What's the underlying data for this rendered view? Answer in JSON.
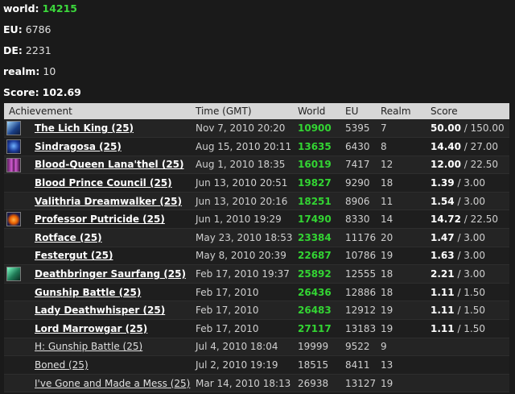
{
  "summary": [
    {
      "key": "world:",
      "value": "14215",
      "style": "green"
    },
    {
      "key": "EU:",
      "value": "6786",
      "style": "normal"
    },
    {
      "key": "DE:",
      "value": "2231",
      "style": "normal"
    },
    {
      "key": "realm:",
      "value": "10",
      "style": "normal"
    },
    {
      "key": "Score:",
      "value": "102.69",
      "style": "bold"
    }
  ],
  "table": {
    "headers": {
      "achievement": "Achievement",
      "time": "Time (GMT)",
      "world": "World",
      "eu": "EU",
      "realm": "Realm",
      "score": "Score"
    },
    "rows": [
      {
        "icon": "lich-king-icon",
        "icon_class": "lich",
        "name": "The Lich King (25)",
        "bold": true,
        "time": "Nov 7, 2010 20:20",
        "world": "10900",
        "world_green": true,
        "eu": "5395",
        "realm": "7",
        "score": "50.00",
        "max": "/ 150.00"
      },
      {
        "icon": "sindragosa-icon",
        "icon_class": "sind",
        "name": "Sindragosa (25)",
        "bold": true,
        "time": "Aug 15, 2010 20:11",
        "world": "13635",
        "world_green": true,
        "eu": "6430",
        "realm": "8",
        "score": "14.40",
        "max": "/ 27.00"
      },
      {
        "icon": "blood-queen-icon",
        "icon_class": "bq",
        "name": "Blood-Queen Lana'thel (25)",
        "bold": true,
        "time": "Aug 1, 2010 18:35",
        "world": "16019",
        "world_green": true,
        "eu": "7417",
        "realm": "12",
        "score": "12.00",
        "max": "/ 22.50"
      },
      {
        "icon": "",
        "icon_class": "",
        "name": "Blood Prince Council (25)",
        "bold": true,
        "time": "Jun 13, 2010 20:51",
        "world": "19827",
        "world_green": true,
        "eu": "9290",
        "realm": "18",
        "score": "1.39",
        "max": "/ 3.00"
      },
      {
        "icon": "",
        "icon_class": "",
        "name": "Valithria Dreamwalker (25)",
        "bold": true,
        "time": "Jun 13, 2010 20:16",
        "world": "18251",
        "world_green": true,
        "eu": "8906",
        "realm": "11",
        "score": "1.54",
        "max": "/ 3.00"
      },
      {
        "icon": "professor-putricide-icon",
        "icon_class": "pp",
        "name": "Professor Putricide (25)",
        "bold": true,
        "time": "Jun 1, 2010 19:29",
        "world": "17490",
        "world_green": true,
        "eu": "8330",
        "realm": "14",
        "score": "14.72",
        "max": "/ 22.50"
      },
      {
        "icon": "",
        "icon_class": "",
        "name": "Rotface (25)",
        "bold": true,
        "time": "May 23, 2010 18:53",
        "world": "23384",
        "world_green": true,
        "eu": "11176",
        "realm": "20",
        "score": "1.47",
        "max": "/ 3.00"
      },
      {
        "icon": "",
        "icon_class": "",
        "name": "Festergut (25)",
        "bold": true,
        "time": "May 8, 2010 20:39",
        "world": "22687",
        "world_green": true,
        "eu": "10786",
        "realm": "19",
        "score": "1.63",
        "max": "/ 3.00"
      },
      {
        "icon": "deathbringer-saurfang-icon",
        "icon_class": "saur",
        "name": "Deathbringer Saurfang (25)",
        "bold": true,
        "time": "Feb 17, 2010 19:37",
        "world": "25892",
        "world_green": true,
        "eu": "12555",
        "realm": "18",
        "score": "2.21",
        "max": "/ 3.00"
      },
      {
        "icon": "",
        "icon_class": "",
        "name": "Gunship Battle (25)",
        "bold": true,
        "time": "Feb 17, 2010",
        "world": "26436",
        "world_green": true,
        "eu": "12886",
        "realm": "18",
        "score": "1.11",
        "max": "/ 1.50"
      },
      {
        "icon": "",
        "icon_class": "",
        "name": "Lady Deathwhisper (25)",
        "bold": true,
        "time": "Feb 17, 2010",
        "world": "26483",
        "world_green": true,
        "eu": "12912",
        "realm": "19",
        "score": "1.11",
        "max": "/ 1.50"
      },
      {
        "icon": "",
        "icon_class": "",
        "name": "Lord Marrowgar (25)",
        "bold": true,
        "time": "Feb 17, 2010",
        "world": "27117",
        "world_green": true,
        "eu": "13183",
        "realm": "19",
        "score": "1.11",
        "max": "/ 1.50"
      },
      {
        "icon": "",
        "icon_class": "",
        "name": "H: Gunship Battle (25)",
        "bold": false,
        "time": "Jul 4, 2010 18:04",
        "world": "19999",
        "world_green": false,
        "eu": "9522",
        "realm": "9",
        "score": "",
        "max": ""
      },
      {
        "icon": "",
        "icon_class": "",
        "name": "Boned (25)",
        "bold": false,
        "time": "Jul 2, 2010 19:19",
        "world": "18515",
        "world_green": false,
        "eu": "8411",
        "realm": "13",
        "score": "",
        "max": ""
      },
      {
        "icon": "",
        "icon_class": "",
        "name": "I've Gone and Made a Mess (25)",
        "bold": false,
        "time": "Mar 14, 2010 18:13",
        "world": "26938",
        "world_green": false,
        "eu": "13127",
        "realm": "19",
        "score": "",
        "max": ""
      }
    ]
  },
  "colors": {
    "green": "#33d433",
    "background": "#1a1a1a",
    "header": "#d7d7d7"
  }
}
